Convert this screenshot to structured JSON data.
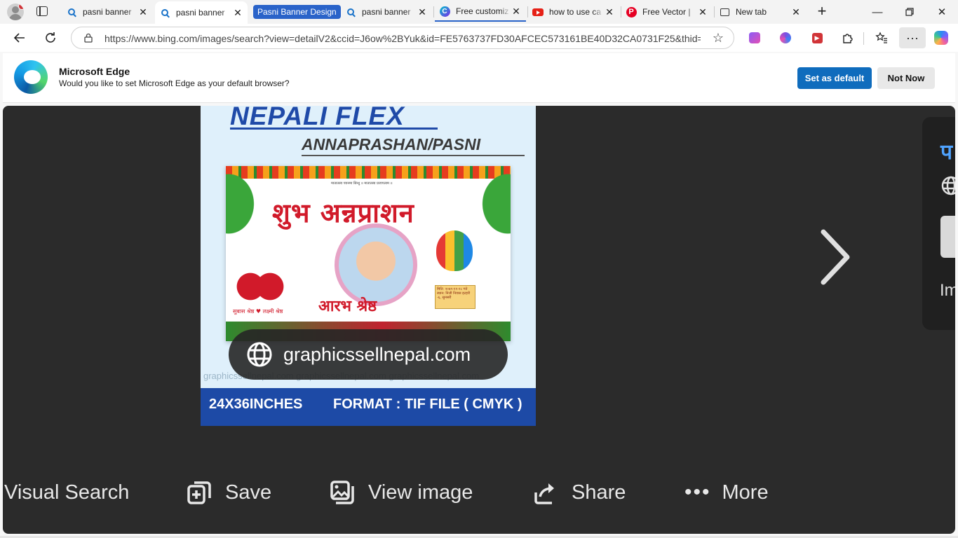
{
  "tabs": [
    {
      "label": "pasni banner",
      "icon": "bing-search-icon"
    },
    {
      "label": "pasni banner",
      "icon": "bing-search-icon",
      "active": true
    },
    {
      "label": "pasni banner",
      "icon": "bing-search-icon"
    },
    {
      "label": "Free customiz",
      "icon": "canva-icon"
    },
    {
      "label": "how to use ca",
      "icon": "youtube-icon"
    },
    {
      "label": "Free Vector |",
      "icon": "pinterest-icon"
    },
    {
      "label": "New tab",
      "icon": "new-tab-icon"
    }
  ],
  "tab_group_label": "Pasni Banner Design",
  "address_bar": {
    "url": "https://www.bing.com/images/search?view=detailV2&ccid=J6ow%2BYuk&id=FE5763737FD30AFCEC573161BE40D32CA0731F25&thid=..."
  },
  "infobar": {
    "title": "Microsoft Edge",
    "message": "Would you like to set Microsoft Edge as your default browser?",
    "primary_button": "Set as default",
    "secondary_button": "Not Now"
  },
  "image": {
    "headline": "NEPALI FLEX",
    "subheadline": "ANNAPRASHAN/PASNI",
    "card_title": "शुभ अन्नप्राशन",
    "card_small_text": "मातातस्य पवनमा सिन्धु ॥ मातातस्य प्रजापत्यम ॥",
    "card_child_name": "आरभ श्रेष्ठ",
    "card_parents": "सुबास श्रेष्ठ ♥ लक्ष्मी श्रेष्ठ",
    "card_notice": "मिति: २०७९-११-२८ गते स्थान: निजी निवास इटहरी -६, सुनसरी",
    "watermark": "graphicssellnepal.com   graphicssellnepal.com   graphicssellnepal.com",
    "size_text": "24X36INCHES",
    "format_text": "FORMAT : TIF FILE ( CMYK )"
  },
  "source": {
    "domain": "graphicssellnepal.com"
  },
  "side_panel": {
    "title_char": "प",
    "label": "Im"
  },
  "actions": {
    "visual_search": "Visual Search",
    "save": "Save",
    "view_image": "View image",
    "share": "Share",
    "more": "More"
  },
  "colors": {
    "accent": "#0f6cbd",
    "viewer_bg": "#2b2b2b",
    "banner_blue": "#1d4aa6",
    "tab_group": "#2a63c9"
  }
}
